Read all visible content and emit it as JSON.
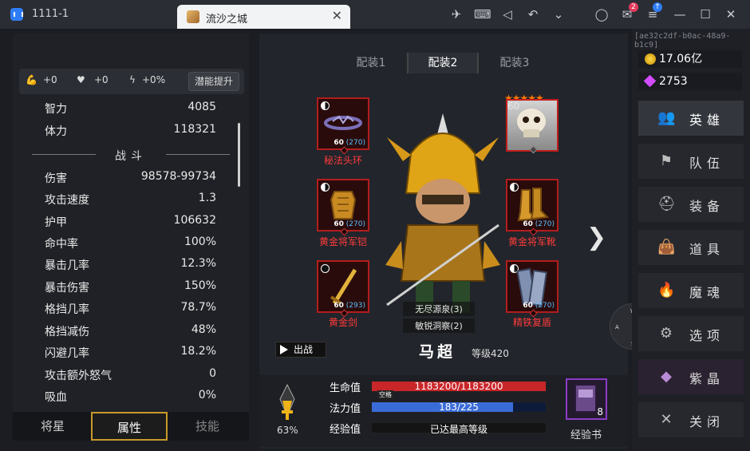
{
  "window": {
    "app_title": "1111-1",
    "tab_title": "流沙之城",
    "notif_count": "2"
  },
  "session_id": "[ae32c2df-b0ac-48a9-b1c9]",
  "potential": {
    "strength": "+0",
    "health": "+0",
    "energy": "+0%",
    "button": "潜能提升"
  },
  "stats": {
    "top": [
      {
        "label": "智力",
        "value": "4085"
      },
      {
        "label": "体力",
        "value": "118321"
      }
    ],
    "section_title": "战斗",
    "combat": [
      {
        "label": "伤害",
        "value": "98578-99734"
      },
      {
        "label": "攻击速度",
        "value": "1.3"
      },
      {
        "label": "护甲",
        "value": "106632"
      },
      {
        "label": "命中率",
        "value": "100%"
      },
      {
        "label": "暴击几率",
        "value": "12.3%"
      },
      {
        "label": "暴击伤害",
        "value": "150%"
      },
      {
        "label": "格挡几率",
        "value": "78.7%"
      },
      {
        "label": "格挡减伤",
        "value": "48%"
      },
      {
        "label": "闪避几率",
        "value": "18.2%"
      },
      {
        "label": "攻击额外怒气",
        "value": "0"
      },
      {
        "label": "吸血",
        "value": "0%"
      }
    ]
  },
  "bottom_tabs": [
    "将星",
    "属性",
    "技能"
  ],
  "loadouts": [
    "配装1",
    "配装2",
    "配装3"
  ],
  "equipment": {
    "head": {
      "name": "秘法头环",
      "level": "60",
      "power": "(270)"
    },
    "chest": {
      "name": "黄金将军铠",
      "level": "60",
      "power": "(270)"
    },
    "weapon": {
      "name": "黄金剑",
      "level": "60",
      "power": "(293)"
    },
    "feet": {
      "name": "黄金将军靴",
      "level": "60",
      "power": "(270)"
    },
    "shield": {
      "name": "精铁复盾",
      "level": "60",
      "power": "(270)"
    }
  },
  "companion": {
    "level": "60",
    "stars": "★★★★★"
  },
  "hero": {
    "name": "马超",
    "level": "等级420",
    "skills": [
      "无尽源泉(3)",
      "敏锐洞察(2)"
    ],
    "deploy": "出战"
  },
  "bars": {
    "hp_label": "生命值",
    "hp_text": "1183200/1183200",
    "hp_fraction": 1.0,
    "mp_label": "法力值",
    "mp_text": "183/225",
    "mp_fraction": 0.813,
    "xp_label": "经验值",
    "xp_text": "已达最高等级",
    "empty_tag": "空格",
    "potion_pct": "63%"
  },
  "exp_book": {
    "count": "8",
    "label": "经验书"
  },
  "currency": {
    "gold": "17.06亿",
    "gems": "2753"
  },
  "menu": [
    {
      "label": "英雄",
      "icon": "people-icon"
    },
    {
      "label": "队伍",
      "icon": "flag-icon"
    },
    {
      "label": "装备",
      "icon": "helmet-icon"
    },
    {
      "label": "道具",
      "icon": "bag-icon"
    },
    {
      "label": "魔魂",
      "icon": "flame-icon"
    },
    {
      "label": "选项",
      "icon": "gear-icon"
    },
    {
      "label": "紫晶",
      "icon": "crystal-icon"
    },
    {
      "label": "关闭",
      "icon": "close-icon"
    }
  ],
  "colors": {
    "hp_fill": "#c9262a",
    "mp_fill": "#3a6cd8",
    "slot_border": "#b21d1d",
    "tab_active_border": "#c89a2a"
  }
}
